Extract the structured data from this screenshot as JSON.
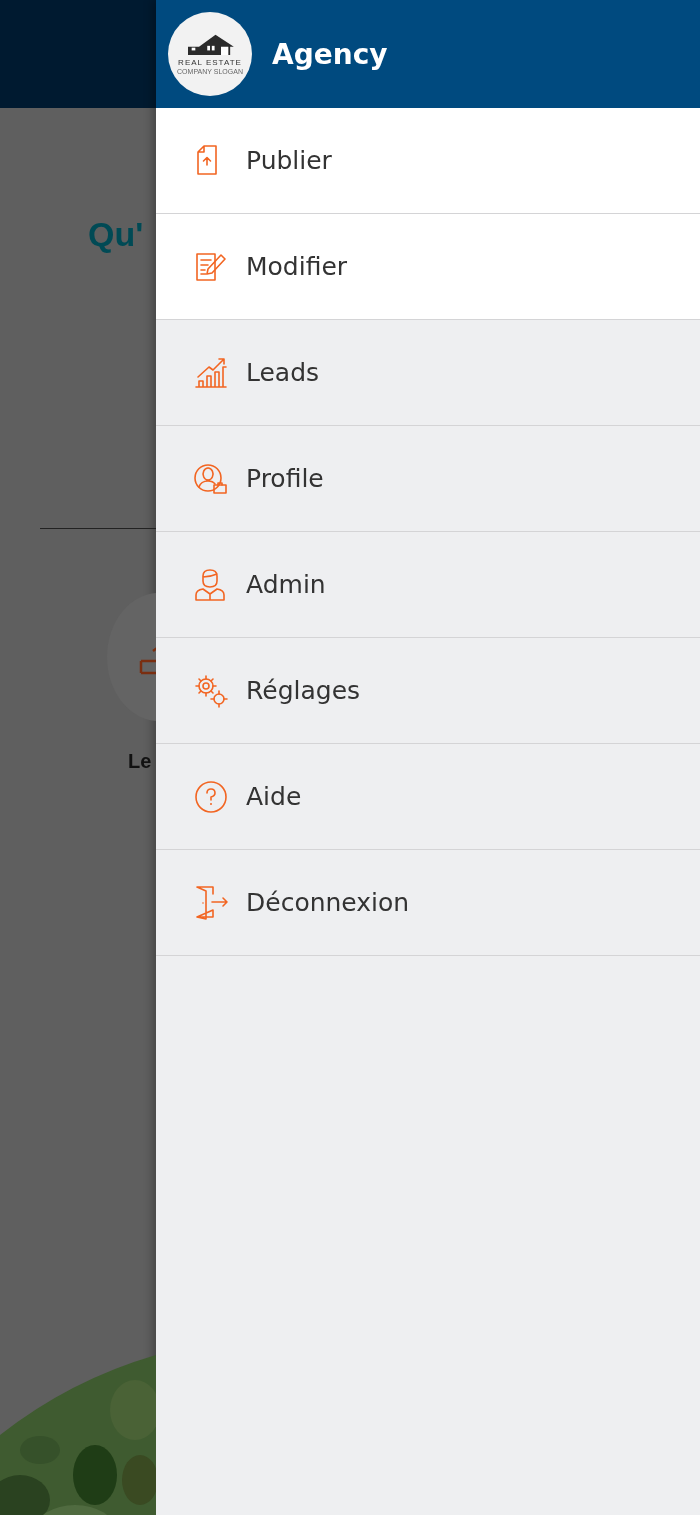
{
  "background_page": {
    "heading": "Qu'",
    "item_label": "Le"
  },
  "drawer": {
    "logo": {
      "title": "REAL ESTATE",
      "slogan": "COMPANY SLOGAN"
    },
    "title": "Agency",
    "items": [
      {
        "label": "Publier",
        "highlighted": true
      },
      {
        "label": "Modifier",
        "highlighted": true
      },
      {
        "label": "Leads",
        "highlighted": false
      },
      {
        "label": "Profile",
        "highlighted": false
      },
      {
        "label": "Admin",
        "highlighted": false
      },
      {
        "label": "Réglages",
        "highlighted": false
      },
      {
        "label": "Aide",
        "highlighted": false
      },
      {
        "label": "Déconnexion",
        "highlighted": false
      }
    ]
  }
}
